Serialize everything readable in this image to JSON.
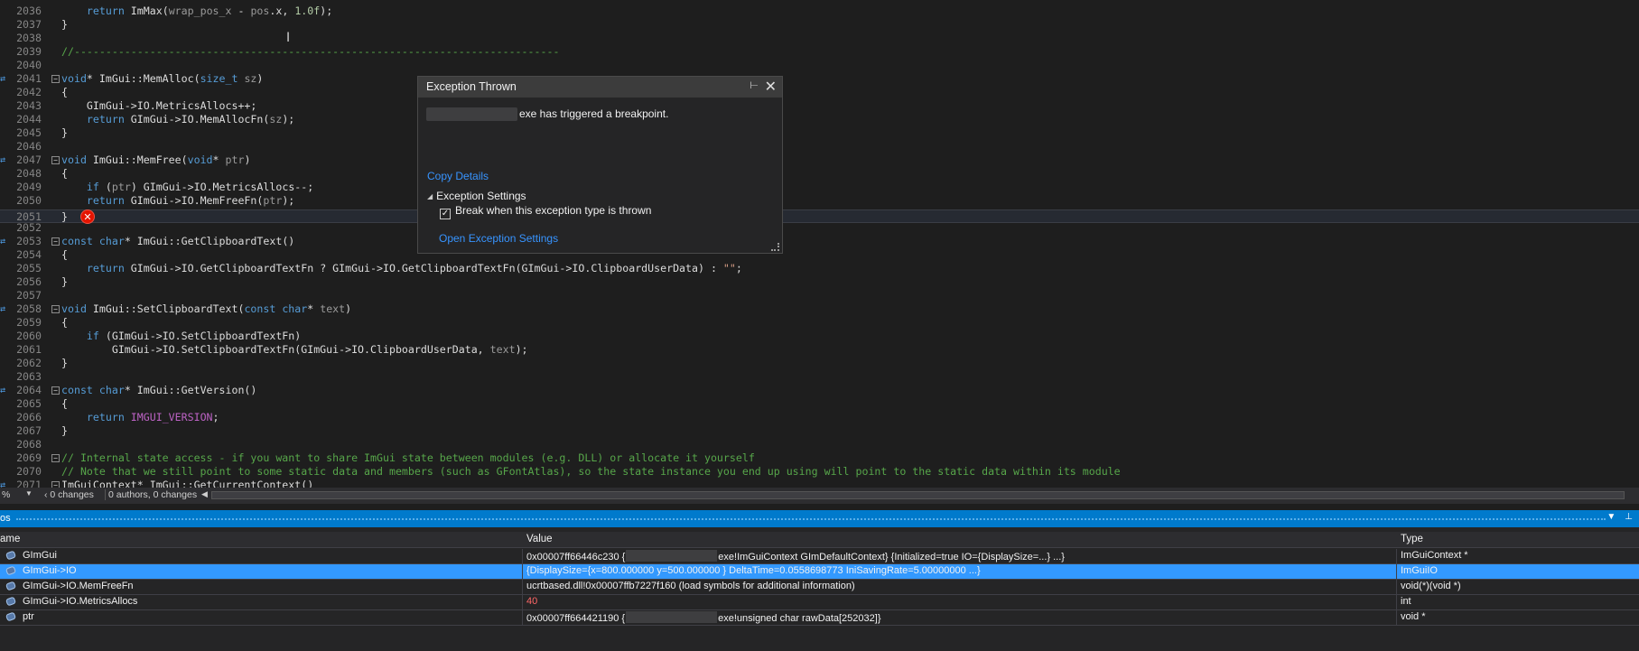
{
  "editor": {
    "lines": [
      {
        "num": "2036",
        "html": "    <span class=\"kw\">return</span> ImMax(<span class=\"prm\">wrap_pos_x</span> - <span class=\"prm\">pos</span>.x, <span class=\"num\">1.0f</span>);"
      },
      {
        "num": "2037",
        "html": "}"
      },
      {
        "num": "2038",
        "html": ""
      },
      {
        "num": "2039",
        "html": "<span class=\"cmt\">//-----------------------------------------------------------------------------</span>"
      },
      {
        "num": "2040",
        "html": ""
      },
      {
        "num": "2041",
        "html": "<span class=\"kw\">void</span>* ImGui::MemAlloc(<span class=\"kw\">size_t</span> <span class=\"prm\">sz</span>)",
        "fold": true,
        "arrow": true
      },
      {
        "num": "2042",
        "html": "{"
      },
      {
        "num": "2043",
        "html": "    GImGui-><span class=\"mem\">IO</span>.MetricsAllocs++;"
      },
      {
        "num": "2044",
        "html": "    <span class=\"kw\">return</span> GImGui->IO.MemAllocFn(<span class=\"prm\">sz</span>);"
      },
      {
        "num": "2045",
        "html": "}"
      },
      {
        "num": "2046",
        "html": ""
      },
      {
        "num": "2047",
        "html": "<span class=\"kw\">void</span> ImGui::MemFree(<span class=\"kw\">void</span>* <span class=\"prm\">ptr</span>)",
        "fold": true,
        "arrow": true
      },
      {
        "num": "2048",
        "html": "{"
      },
      {
        "num": "2049",
        "html": "    <span class=\"kw\">if</span> (<span class=\"prm\">ptr</span>) GImGui->IO.MetricsAllocs--;"
      },
      {
        "num": "2050",
        "html": "    <span class=\"kw\">return</span> GImGui->IO.MemFreeFn(<span class=\"prm\">ptr</span>);"
      },
      {
        "num": "2051",
        "html": "}",
        "current": true
      },
      {
        "num": "2052",
        "html": ""
      },
      {
        "num": "2053",
        "html": "<span class=\"kw\">const</span> <span class=\"kw\">char</span>* ImGui::GetClipboardText()",
        "fold": true,
        "arrow": true
      },
      {
        "num": "2054",
        "html": "{"
      },
      {
        "num": "2055",
        "html": "    <span class=\"kw\">return</span> GImGui->IO.GetClipboardTextFn ? GImGui->IO.GetClipboardTextFn(GImGui->IO.ClipboardUserData) : <span class=\"str\">\"\"</span>;"
      },
      {
        "num": "2056",
        "html": "}"
      },
      {
        "num": "2057",
        "html": ""
      },
      {
        "num": "2058",
        "html": "<span class=\"kw\">void</span> ImGui::SetClipboardText(<span class=\"kw\">const</span> <span class=\"kw\">char</span>* <span class=\"prm\">text</span>)",
        "fold": true,
        "arrow": true
      },
      {
        "num": "2059",
        "html": "{"
      },
      {
        "num": "2060",
        "html": "    <span class=\"kw\">if</span> (GImGui->IO.SetClipboardTextFn)"
      },
      {
        "num": "2061",
        "html": "        GImGui->IO.SetClipboardTextFn(GImGui->IO.ClipboardUserData, <span class=\"prm\">text</span>);"
      },
      {
        "num": "2062",
        "html": "}"
      },
      {
        "num": "2063",
        "html": ""
      },
      {
        "num": "2064",
        "html": "<span class=\"kw\">const</span> <span class=\"kw\">char</span>* ImGui::GetVersion()",
        "fold": true,
        "arrow": true
      },
      {
        "num": "2065",
        "html": "{"
      },
      {
        "num": "2066",
        "html": "    <span class=\"kw\">return</span> <span class=\"mac\">IMGUI_VERSION</span>;"
      },
      {
        "num": "2067",
        "html": "}"
      },
      {
        "num": "2068",
        "html": ""
      },
      {
        "num": "2069",
        "html": "<span class=\"cmt\">// Internal state access - if you want to share ImGui state between modules (e.g. DLL) or allocate it yourself</span>",
        "fold": true
      },
      {
        "num": "2070",
        "html": "<span class=\"cmt\">// Note that we still point to some static data and members (such as GFontAtlas), so the state instance you end up using will point to the static data within its module</span>"
      },
      {
        "num": "2071",
        "html": "ImGuiContext* ImGui::GetCurrentContext()",
        "fold": true,
        "arrow": true
      }
    ]
  },
  "exception": {
    "title": "Exception Thrown",
    "message": "exe has triggered a breakpoint.",
    "copy_details": "Copy Details",
    "settings_label": "Exception Settings",
    "checkbox_label": "Break when this exception type is thrown",
    "open_settings": "Open Exception Settings"
  },
  "status": {
    "zoom": "%",
    "changes": "0 changes",
    "authors": "0 authors, 0 changes"
  },
  "autos": {
    "title": "os",
    "columns": {
      "name": "ame",
      "value": "Value",
      "type": "Type"
    },
    "rows": [
      {
        "name": "GImGui",
        "value_pre": "0x00007ff66446c230 {",
        "value_post": "exe!ImGuiContext GImDefaultContext} {Initialized=true IO={DisplaySize=...} ...}",
        "blur": true,
        "type": "ImGuiContext *"
      },
      {
        "name": "GImGui->IO",
        "value_pre": "{DisplaySize={x=800.000000 y=500.000000 } DeltaTime=0.0558698773 IniSavingRate=5.00000000 ...}",
        "value_post": "",
        "blur": false,
        "type": "ImGuiIO",
        "selected": true
      },
      {
        "name": "GImGui->IO.MemFreeFn",
        "value_pre": "ucrtbased.dll!0x00007ffb7227f160 (load symbols for additional information)",
        "value_post": "",
        "blur": false,
        "type": "void(*)(void *)"
      },
      {
        "name": "GImGui->IO.MetricsAllocs",
        "value_pre": "40",
        "value_post": "",
        "blur": false,
        "type": "int",
        "red": true
      },
      {
        "name": "ptr",
        "value_pre": "0x00007ff664421190 {",
        "value_post": "exe!unsigned char rawData[252032]}",
        "blur": true,
        "type": "void *"
      }
    ]
  }
}
